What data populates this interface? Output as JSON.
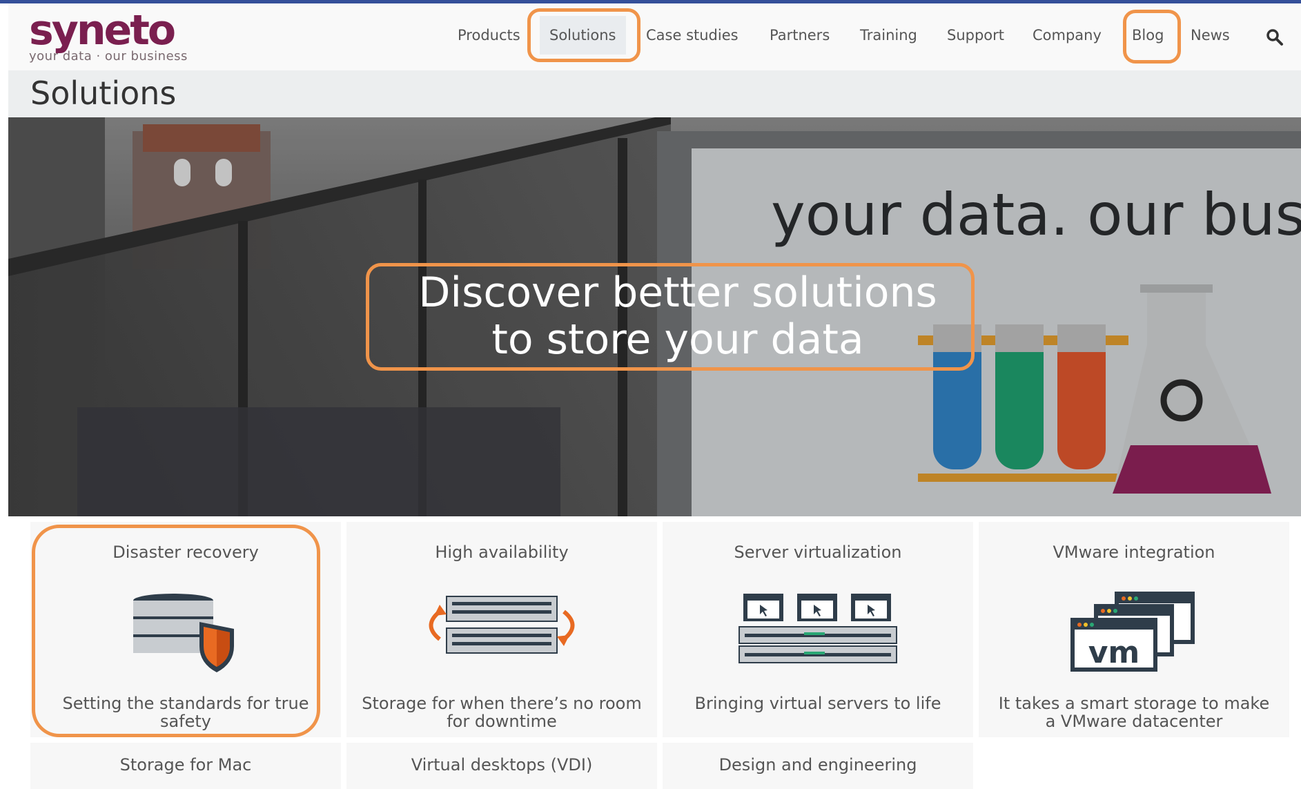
{
  "brand": {
    "name": "syneto",
    "tagline": "your data · our business"
  },
  "nav": {
    "items": [
      "Products",
      "Solutions",
      "Case studies",
      "Partners",
      "Training",
      "Support",
      "Company",
      "Blog",
      "News"
    ],
    "active": "Solutions",
    "search_icon": "search-icon"
  },
  "page": {
    "title": "Solutions"
  },
  "hero": {
    "headline_line1": "Discover better solutions",
    "headline_line2": "to store your data",
    "billboard_text": "your data. our busin"
  },
  "cards": [
    {
      "title": "Disaster recovery",
      "desc": "Setting the standards for true safety",
      "icon": "database-shield-icon"
    },
    {
      "title": "High availability",
      "desc": "Storage for when there’s no room for downtime",
      "icon": "servers-sync-icon"
    },
    {
      "title": "Server virtualization",
      "desc": "Bringing virtual servers to life",
      "icon": "virtual-servers-icon"
    },
    {
      "title": "VMware integration",
      "desc": "It takes a smart storage to make a VMware datacenter",
      "icon": "vm-windows-icon"
    }
  ],
  "cards_row2": [
    {
      "title": "Storage for Mac"
    },
    {
      "title": "Virtual desktops (VDI)"
    },
    {
      "title": "Design and engineering"
    }
  ],
  "colors": {
    "brand": "#7a1f4f",
    "highlight": "#f0944a",
    "top_line": "#35509a"
  }
}
